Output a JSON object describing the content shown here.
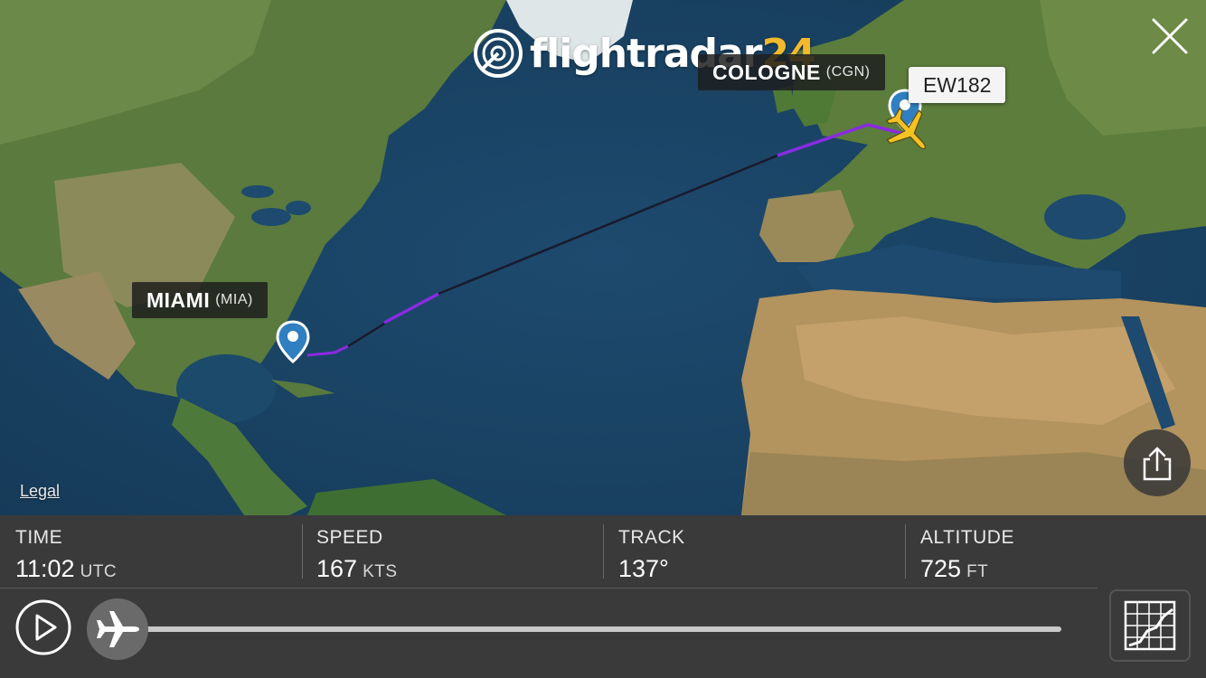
{
  "logo": {
    "text": "flightradar",
    "number": "24"
  },
  "airports": {
    "origin": {
      "name": "MIAMI",
      "code": "(MIA)"
    },
    "destination": {
      "name": "COLOGNE",
      "code": "(CGN)"
    }
  },
  "flight": {
    "callsign": "EW182"
  },
  "map": {
    "legal_label": "Legal"
  },
  "stats": {
    "time": {
      "label": "TIME",
      "value": "11:02",
      "unit": "UTC"
    },
    "speed": {
      "label": "SPEED",
      "value": "167",
      "unit": "KTS"
    },
    "track": {
      "label": "TRACK",
      "value": "137°",
      "unit": ""
    },
    "altitude": {
      "label": "ALTITUDE",
      "value": "725",
      "unit": "FT"
    }
  },
  "playback": {
    "progress": 0.0
  },
  "icons": {
    "close": "close-icon",
    "share": "share-icon",
    "play": "play-icon",
    "aircraft": "aircraft-icon",
    "graph": "graph-icon",
    "pin": "map-pin-icon",
    "radar": "radar-logo-icon"
  },
  "colors": {
    "route_purple": "#8a2be2",
    "route_dark": "#1a1a2e",
    "aircraft_yellow": "#f3c323",
    "pin_blue": "#2f7fc1",
    "logo_yellow": "#f3b92c",
    "panel_bg": "#3a3a3a"
  }
}
